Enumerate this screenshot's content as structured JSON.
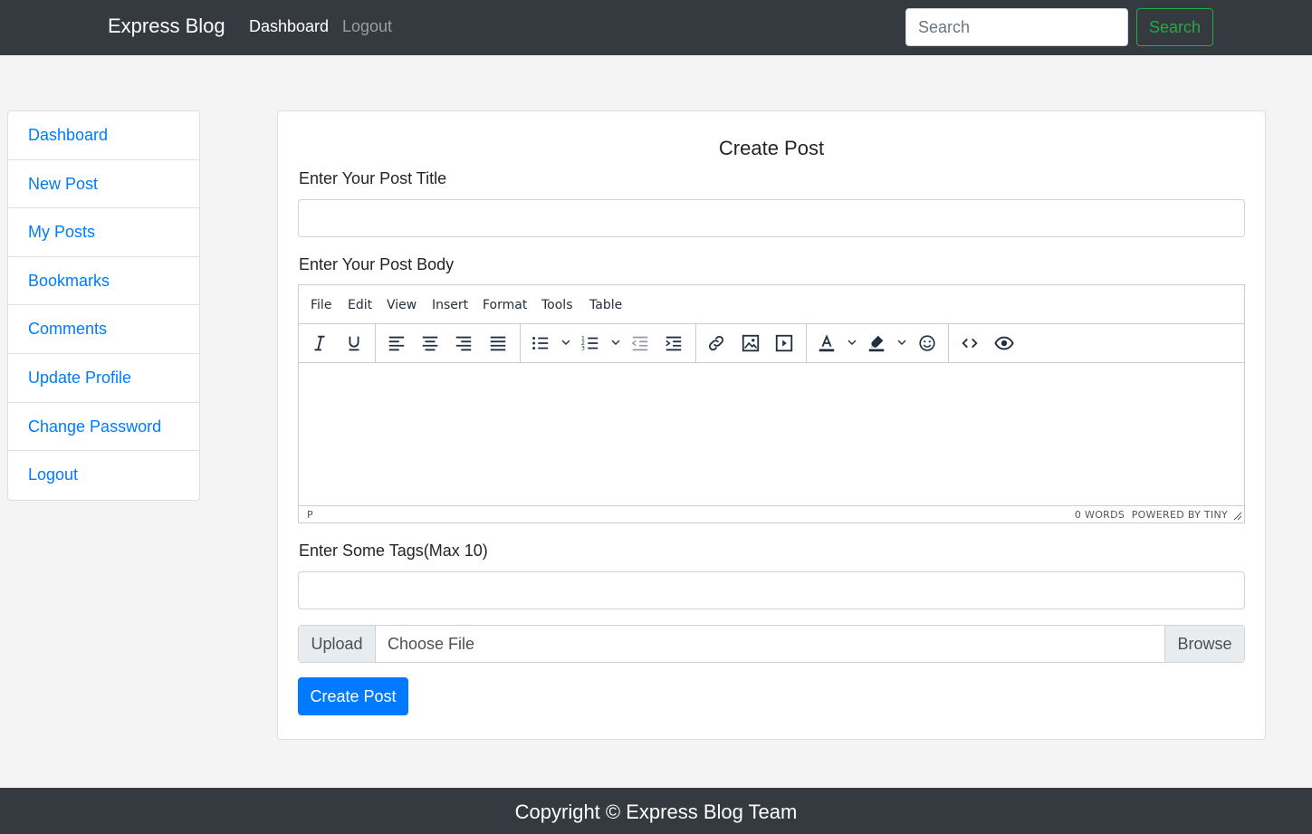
{
  "navbar": {
    "brand": "Express Blog",
    "links": [
      "Dashboard",
      "Logout"
    ],
    "search_placeholder": "Search",
    "search_button": "Search"
  },
  "sidebar": {
    "items": [
      "Dashboard",
      "New Post",
      "My Posts",
      "Bookmarks",
      "Comments",
      "Update Profile",
      "Change Password",
      "Logout"
    ]
  },
  "form": {
    "title": "Create Post",
    "title_label": "Enter Your Post Title",
    "title_value": "",
    "body_label": "Enter Your Post Body",
    "tags_label": "Enter Some Tags(Max 10)",
    "tags_value": "",
    "upload_prepend": "Upload",
    "upload_placeholder": "Choose File",
    "upload_browse": "Browse",
    "submit": "Create Post"
  },
  "editor": {
    "menu": [
      "File",
      "Edit",
      "View",
      "Insert",
      "Format",
      "Tools",
      "Table"
    ],
    "toolbar_icons": [
      "italic-icon",
      "underline-icon",
      "align-left-icon",
      "align-center-icon",
      "align-right-icon",
      "align-justify-icon",
      "bullet-list-icon",
      "numbered-list-icon",
      "outdent-icon",
      "indent-icon",
      "link-icon",
      "image-icon",
      "media-icon",
      "text-color-icon",
      "highlight-icon",
      "emoticon-icon",
      "code-icon",
      "preview-icon"
    ],
    "status_path": "P",
    "status_right": "0 WORDS  POWERED BY TINY"
  },
  "footer": {
    "text": "Copyright © Express Blog Team"
  },
  "colors": {
    "navbar_bg": "#343a40",
    "link": "#007bff",
    "success": "#28a745",
    "primary": "#007bff",
    "page_bg": "#f4f4f4"
  }
}
